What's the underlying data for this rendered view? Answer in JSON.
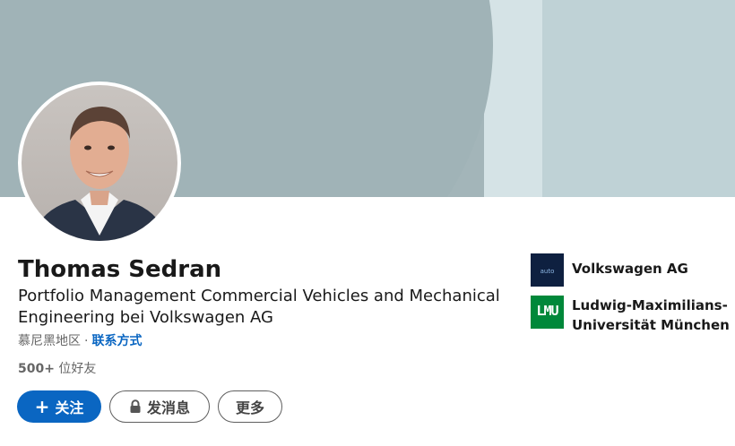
{
  "profile": {
    "name": "Thomas Sedran",
    "headline": "Portfolio Management Commercial Vehicles and Mechanical Engineering bei Volkswagen AG",
    "location": "慕尼黑地区",
    "separator": "·",
    "contact_info": "联系方式",
    "connections_count": "500+",
    "connections_label": "位好友"
  },
  "actions": {
    "follow_icon": "+",
    "follow_label": "关注",
    "message_label": "发消息",
    "more_label": "更多"
  },
  "organizations": [
    {
      "name": "Volkswagen AG",
      "logo_icon": "volkswagen-logo",
      "logo_text": "auto"
    },
    {
      "name": "Ludwig-Maximilians-Universität München",
      "logo_icon": "lmu-logo",
      "logo_text": "LMU"
    }
  ],
  "colors": {
    "primary": "#0a66c2",
    "cover": "#a3b5b9",
    "lmu_green": "#00883a"
  }
}
